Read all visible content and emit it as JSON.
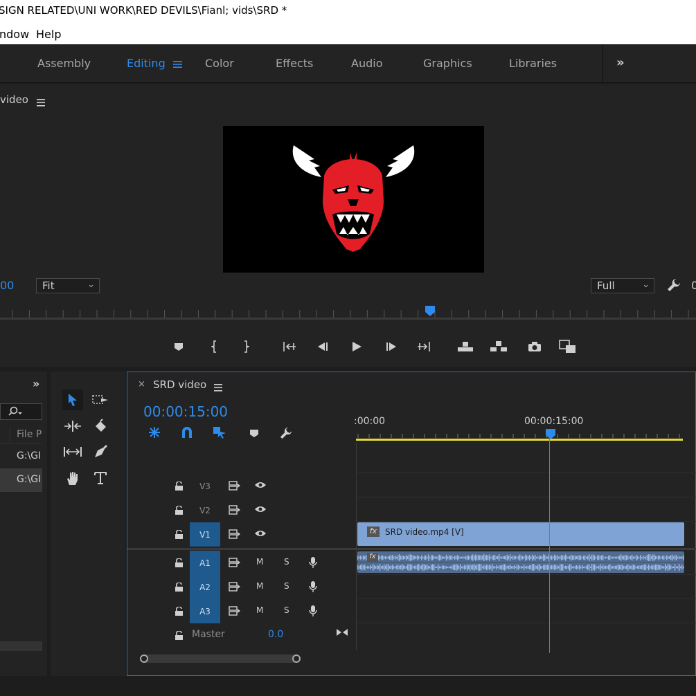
{
  "window": {
    "title": "SIGN RELATED\\UNI WORK\\RED DEVILS\\Fianl; vids\\SRD *"
  },
  "menu": {
    "items": [
      "ndow",
      "Help"
    ]
  },
  "workspaces": {
    "tabs": [
      "Assembly",
      "Editing",
      "Color",
      "Effects",
      "Audio",
      "Graphics",
      "Libraries"
    ],
    "active": "Editing",
    "overflow": "»"
  },
  "program": {
    "title": "video",
    "timecode_partial": "00",
    "fit_value": "Fit",
    "quality_value": "Full",
    "clipped_right": "0"
  },
  "project": {
    "overflow": "»",
    "column_header": "File P",
    "rows": [
      "G:\\GI",
      "G:\\GI"
    ]
  },
  "timeline": {
    "sequence_name": "SRD video",
    "close": "×",
    "timecode": "00:00:15:00",
    "ruler_labels": [
      ":00:00",
      "00:00:15:00"
    ],
    "video_tracks": [
      "V3",
      "V2",
      "V1"
    ],
    "audio_tracks": [
      "A1",
      "A2",
      "A3"
    ],
    "mute_label": "M",
    "solo_label": "S",
    "master_label": "Master",
    "master_value": "0.0",
    "clip_name": "SRD video.mp4 [V]",
    "fx_label": "fx"
  },
  "colors": {
    "accent": "#2d8ceb",
    "clip": "#7fa3d4",
    "track_active": "#1f5a8e",
    "work_area": "#e6d93a"
  }
}
